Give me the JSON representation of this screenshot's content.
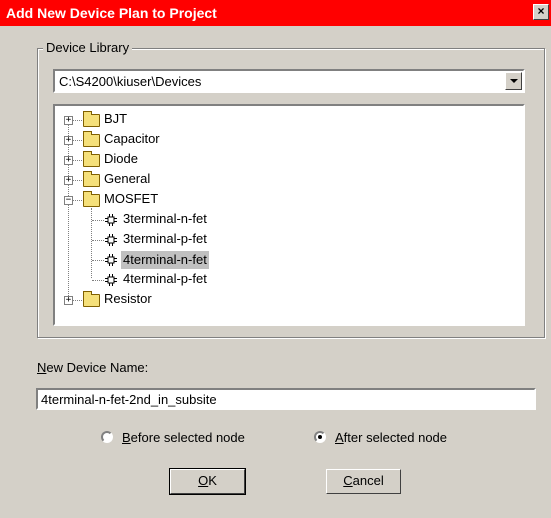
{
  "window": {
    "title": "Add New Device Plan to Project",
    "close_glyph": "×",
    "accent_color": "#ff0000"
  },
  "device_library": {
    "legend": "Device Library",
    "path": "C:\\S4200\\kiuser\\Devices"
  },
  "tree": {
    "nodes": [
      {
        "label": "BJT",
        "type": "folder",
        "expander": "+"
      },
      {
        "label": "Capacitor",
        "type": "folder",
        "expander": "+"
      },
      {
        "label": "Diode",
        "type": "folder",
        "expander": "+"
      },
      {
        "label": "General",
        "type": "folder",
        "expander": "+"
      },
      {
        "label": "MOSFET",
        "type": "folder",
        "expander": "−"
      },
      {
        "label": "3terminal-n-fet",
        "type": "device"
      },
      {
        "label": "3terminal-p-fet",
        "type": "device"
      },
      {
        "label": "4terminal-n-fet",
        "type": "device",
        "selected": true
      },
      {
        "label": "4terminal-p-fet",
        "type": "device"
      },
      {
        "label": "Resistor",
        "type": "folder",
        "expander": "+"
      }
    ]
  },
  "new_device": {
    "label_first": "N",
    "label_rest": "ew Device Name:",
    "value": "4terminal-n-fet-2nd_in_subsite"
  },
  "position": {
    "before_first": "B",
    "before_rest": "efore selected node",
    "after_first": "A",
    "after_rest": "fter selected node",
    "selected": "after"
  },
  "buttons": {
    "ok_first": "O",
    "ok_rest": "K",
    "cancel_first": "C",
    "cancel_rest": "ancel"
  }
}
